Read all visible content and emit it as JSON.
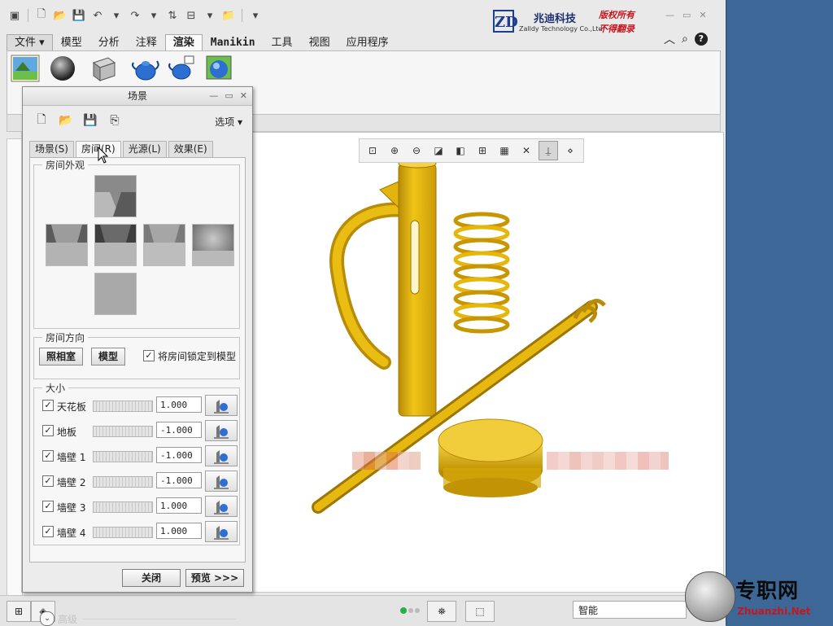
{
  "app": {
    "logo": {
      "mark": "ZD",
      "name_cn": "兆迪科技",
      "name_en": "Zalldy Technology Co.,Ltd.",
      "rights_1": "版权所有",
      "rights_2": "不得翻录"
    },
    "ribbon_tabs": [
      "文件",
      "模型",
      "分析",
      "注释",
      "渲染",
      "Manikin",
      "工具",
      "视图",
      "应用程序"
    ],
    "active_tab": "渲染",
    "status": {
      "selection_filter": "智能"
    }
  },
  "dialog": {
    "title": "场景",
    "options_label": "选项",
    "tabs": [
      "场景(S)",
      "房间(R)",
      "光源(L)",
      "效果(E)"
    ],
    "active_tab": "房间(R)",
    "appearance": {
      "label": "房间外观"
    },
    "orientation": {
      "label": "房间方向",
      "studio_button": "照相室",
      "model_button": "模型",
      "lock_label": "将房间锁定到模型",
      "lock_checked": true
    },
    "size": {
      "label": "大小",
      "rows": [
        {
          "label": "天花板",
          "value": "1.000",
          "checked": true
        },
        {
          "label": "地板",
          "value": "-1.000",
          "checked": true
        },
        {
          "label": "墙壁 1",
          "value": "-1.000",
          "checked": true
        },
        {
          "label": "墙壁 2",
          "value": "-1.000",
          "checked": true
        },
        {
          "label": "墙壁 3",
          "value": "1.000",
          "checked": true
        },
        {
          "label": "墙壁 4",
          "value": "1.000",
          "checked": true
        }
      ]
    },
    "advanced_label": "高级",
    "close_button": "关闭",
    "preview_button": "预览 >>>"
  },
  "watermark": {
    "cn": "专职网",
    "en": "Zhuanzhi.Net"
  },
  "colors": {
    "model_yellow": "#e3b30c",
    "background_blue": "#3d6796"
  }
}
